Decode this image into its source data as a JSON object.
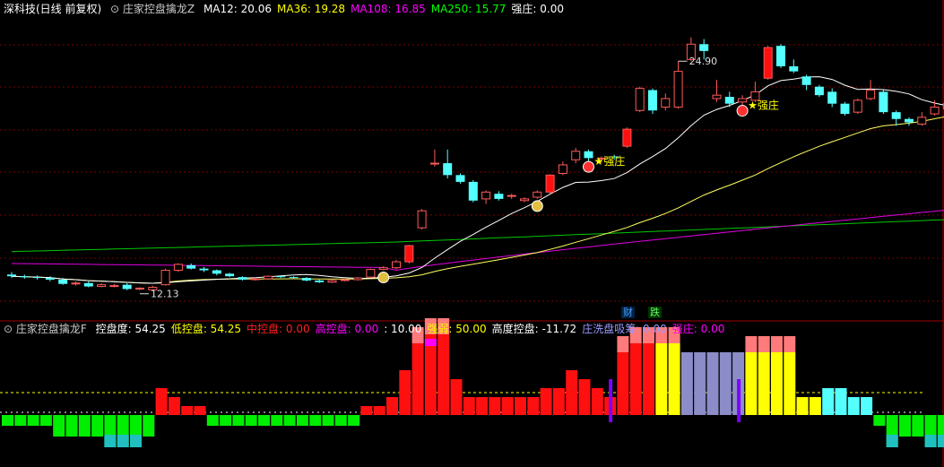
{
  "main_chart": {
    "title": "深科技(日线 前复权)",
    "indicator_name": "庄家控盘擒龙Z",
    "ma": [
      {
        "label": "MA12:",
        "value": "20.06",
        "color": "#ffffff"
      },
      {
        "label": "MA36:",
        "value": "19.28",
        "color": "#ffff00"
      },
      {
        "label": "MA108:",
        "value": "16.85",
        "color": "#ff00ff"
      },
      {
        "label": "MA250:",
        "value": "15.77",
        "color": "#00ff00"
      },
      {
        "label": "强庄:",
        "value": "0.00",
        "color": "#ffffff"
      }
    ],
    "high_label": "24.90",
    "low_label": "12.13",
    "signal_labels": [
      "强庄",
      "强庄"
    ],
    "colors": {
      "up": "#ff5a5a",
      "down": "#54ffff",
      "grid": "#7a0000"
    }
  },
  "flags": {
    "cai": "财",
    "die": "跌"
  },
  "sub_chart": {
    "indicator_name": "庄家控盘擒龙F",
    "values": [
      {
        "label": "控盘度:",
        "value": "54.25",
        "color": "#ffffff"
      },
      {
        "label": "低控盘:",
        "value": "54.25",
        "color": "#ffff00"
      },
      {
        "label": "中控盘:",
        "value": "0.00",
        "color": "#ff2020"
      },
      {
        "label": "高控盘:",
        "value": "0.00",
        "color": "#ff00ff"
      },
      {
        "label": ":",
        "value": "10.00",
        "color": "#ffffff"
      },
      {
        "label": "强弱:",
        "value": "50.00",
        "color": "#ffff00"
      },
      {
        "label": "高度控盘:",
        "value": "-11.72",
        "color": "#ffffff"
      },
      {
        "label": "庄洗盘吸筹:",
        "value": "0.00",
        "color": "#9999ff"
      },
      {
        "label": "强庄:",
        "value": "0.00",
        "color": "#ff00ff"
      }
    ]
  },
  "chart_data": {
    "type": "candlestick",
    "candles": [
      [
        13.05,
        12.95,
        13.2,
        12.85
      ],
      [
        12.95,
        12.9,
        13.05,
        12.8
      ],
      [
        12.9,
        12.85,
        13.0,
        12.75
      ],
      [
        12.85,
        12.75,
        12.95,
        12.65
      ],
      [
        12.75,
        12.5,
        12.85,
        12.45
      ],
      [
        12.5,
        12.55,
        12.65,
        12.4
      ],
      [
        12.55,
        12.35,
        12.65,
        12.3
      ],
      [
        12.35,
        12.45,
        12.55,
        12.3
      ],
      [
        12.4,
        12.4,
        12.5,
        12.3
      ],
      [
        12.45,
        12.2,
        12.55,
        12.13
      ],
      [
        12.2,
        12.25,
        12.3,
        12.13
      ],
      [
        12.15,
        12.3,
        12.4,
        12.13
      ],
      [
        12.45,
        13.3,
        13.4,
        12.4
      ],
      [
        13.3,
        13.65,
        13.7,
        13.2
      ],
      [
        13.6,
        13.4,
        13.7,
        13.35
      ],
      [
        13.4,
        13.3,
        13.5,
        13.2
      ],
      [
        13.3,
        13.1,
        13.35,
        13.0
      ],
      [
        13.1,
        12.95,
        13.15,
        12.9
      ],
      [
        12.9,
        12.75,
        12.95,
        12.7
      ],
      [
        12.75,
        12.8,
        12.9,
        12.7
      ],
      [
        12.8,
        12.95,
        13.0,
        12.75
      ],
      [
        12.95,
        12.9,
        13.0,
        12.85
      ],
      [
        12.9,
        12.85,
        12.95,
        12.8
      ],
      [
        12.85,
        12.7,
        12.9,
        12.65
      ],
      [
        12.7,
        12.6,
        12.75,
        12.55
      ],
      [
        12.6,
        12.7,
        12.75,
        12.55
      ],
      [
        12.7,
        12.75,
        12.8,
        12.65
      ],
      [
        12.75,
        12.85,
        12.9,
        12.7
      ],
      [
        12.9,
        13.35,
        13.4,
        12.85
      ],
      [
        13.35,
        13.45,
        13.55,
        13.3
      ],
      [
        13.45,
        13.8,
        13.9,
        13.35
      ],
      [
        13.8,
        14.75,
        14.8,
        13.7
      ],
      [
        15.8,
        16.8,
        16.9,
        15.7
      ],
      [
        19.6,
        19.6,
        20.4,
        19.4
      ],
      [
        19.6,
        18.9,
        20.4,
        18.7
      ],
      [
        18.9,
        18.5,
        19.0,
        18.4
      ],
      [
        18.5,
        17.4,
        18.6,
        17.3
      ],
      [
        17.5,
        17.9,
        18.0,
        17.2
      ],
      [
        17.8,
        17.5,
        17.95,
        17.4
      ],
      [
        17.7,
        17.7,
        17.8,
        17.5
      ],
      [
        17.4,
        17.5,
        17.6,
        17.3
      ],
      [
        17.6,
        17.9,
        18.0,
        17.5
      ],
      [
        17.9,
        18.9,
        18.95,
        17.8
      ],
      [
        19.0,
        19.5,
        19.7,
        18.9
      ],
      [
        19.8,
        20.3,
        20.5,
        19.6
      ],
      [
        20.3,
        19.9,
        20.4,
        19.7
      ],
      [
        19.9,
        19.9,
        20.0,
        19.6
      ],
      [
        20.0,
        19.95,
        20.1,
        19.8
      ],
      [
        20.6,
        21.6,
        21.7,
        20.5
      ],
      [
        22.7,
        24.0,
        24.1,
        22.6
      ],
      [
        23.9,
        22.7,
        24.0,
        22.5
      ],
      [
        22.9,
        23.4,
        23.7,
        22.7
      ],
      [
        22.9,
        25.0,
        25.6,
        22.8
      ],
      [
        25.7,
        26.6,
        27.0,
        25.6
      ],
      [
        26.6,
        26.2,
        26.9,
        25.7
      ],
      [
        23.4,
        23.6,
        24.5,
        23.2
      ],
      [
        23.5,
        23.1,
        23.8,
        22.9
      ],
      [
        23.2,
        23.4,
        23.6,
        23.0
      ],
      [
        23.3,
        23.8,
        24.4,
        23.2
      ],
      [
        24.6,
        26.4,
        26.5,
        24.5
      ],
      [
        26.5,
        25.3,
        26.6,
        25.2
      ],
      [
        25.3,
        25.0,
        25.7,
        24.9
      ],
      [
        24.7,
        24.2,
        24.8,
        23.9
      ],
      [
        24.1,
        23.6,
        24.2,
        23.5
      ],
      [
        23.8,
        23.1,
        24.0,
        22.9
      ],
      [
        23.1,
        22.5,
        23.2,
        22.4
      ],
      [
        22.6,
        23.3,
        23.4,
        22.5
      ],
      [
        23.4,
        23.9,
        24.5,
        23.3
      ],
      [
        23.8,
        22.6,
        23.9,
        22.5
      ],
      [
        22.6,
        22.2,
        22.7,
        21.8
      ],
      [
        22.2,
        22.0,
        22.3,
        21.8
      ],
      [
        21.9,
        22.3,
        22.6,
        21.8
      ],
      [
        22.5,
        22.9,
        23.3,
        22.4
      ],
      [
        22.8,
        23.1,
        23.8,
        22.7
      ]
    ],
    "high": 24.9,
    "low": 12.13,
    "ma_current": {
      "MA12": 20.06,
      "MA36": 19.28,
      "MA108": 16.85,
      "MA250": 15.77
    },
    "sub_levels": [
      -1,
      -1,
      -1,
      -1,
      -2,
      -2,
      -2,
      -2,
      -3,
      -3,
      -3,
      -2,
      3,
      2,
      1,
      1,
      -1,
      -1,
      -1,
      -1,
      -1,
      -1,
      -1,
      -1,
      -1,
      -1,
      -1,
      -1,
      1,
      1,
      2,
      5,
      8,
      9,
      9,
      4,
      2,
      2,
      2,
      2,
      2,
      2,
      3,
      3,
      5,
      4,
      3,
      2,
      7,
      8,
      8,
      8,
      8,
      7,
      7,
      7,
      7,
      7,
      7,
      7,
      7,
      7,
      2,
      2,
      3,
      3,
      2,
      2,
      -1,
      -3,
      -2,
      -2,
      -3,
      -3
    ],
    "sub_ylim": [
      -4,
      10
    ]
  }
}
